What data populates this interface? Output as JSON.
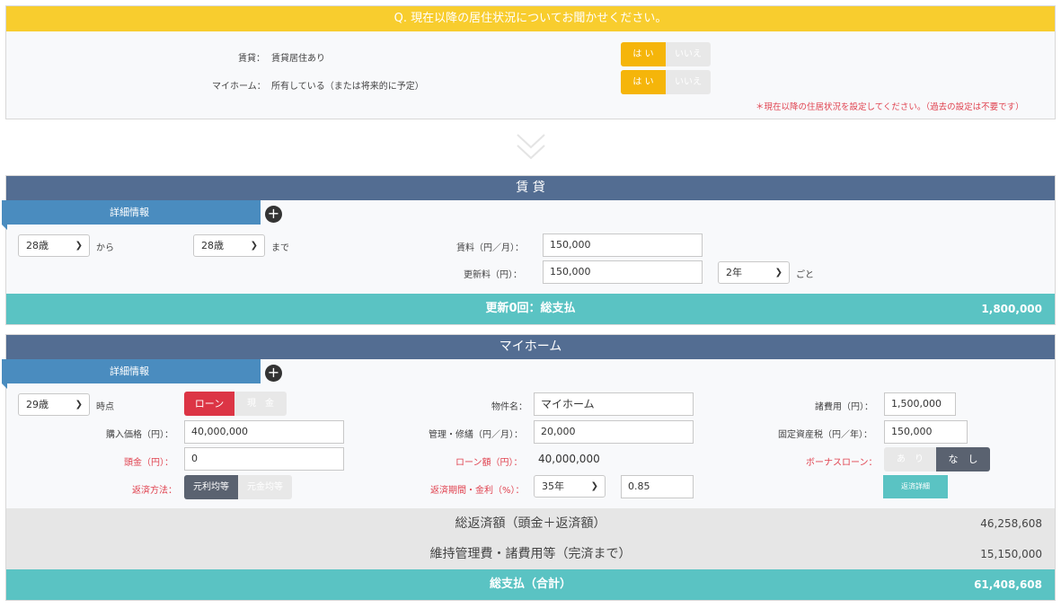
{
  "question": {
    "header": "Q. 現在以降の居住状況についてお聞かせください。",
    "rows": [
      {
        "label": "賃貸：",
        "value": "賃貸居住あり",
        "yes": "は い",
        "no": "いいえ"
      },
      {
        "label": "マイホーム：",
        "value": "所有している（または将来的に予定）",
        "yes": "は い",
        "no": "いいえ"
      }
    ],
    "note": "＊現在以降の住居状況を設定してください。（過去の設定は不要です）"
  },
  "rent": {
    "title": "賃 貸",
    "detail_tab": "詳細情報",
    "plus": "+",
    "from_age": "28歳",
    "from_label": "から",
    "to_age": "28歳",
    "to_label": "まで",
    "rent_label": "賃料（円／月）：",
    "rent_value": "150,000",
    "renewal_label": "更新料（円）：",
    "renewal_value": "150,000",
    "renewal_period": "2年",
    "renewal_suffix": "ごと",
    "total_label": "更新0回：総支払",
    "total_value": "1,800,000"
  },
  "home": {
    "title": "マイホーム",
    "detail_tab": "詳細情報",
    "plus": "+",
    "age": "29歳",
    "age_label": "時点",
    "loan_btn": "ローン",
    "cash_btn": "現　金",
    "price_label": "購入価格（円）：",
    "price_value": "40,000,000",
    "down_label": "頭金（円）：",
    "down_value": "0",
    "repay_method_label": "返済方法：",
    "repay_equal_payment": "元利均等",
    "repay_equal_principal": "元金均等",
    "property_label": "物件名：",
    "property_value": "マイホーム",
    "mgmt_label": "管理・修繕（円／月）：",
    "mgmt_value": "20,000",
    "loan_amount_label": "ローン額（円）：",
    "loan_amount_value": "40,000,000",
    "period_label": "返済期間・金利（%）：",
    "period_value": "35年",
    "rate_value": "0.85",
    "fees_label": "諸費用（円）：",
    "fees_value": "1,500,000",
    "tax_label": "固定資産税（円／年）：",
    "tax_value": "150,000",
    "bonus_label": "ボーナスローン：",
    "bonus_yes": "あ　り",
    "bonus_no": "な　し",
    "repay_detail_btn": "返済詳細",
    "total_repay_label": "総返済額（頭金＋返済額）",
    "total_repay_value": "46,258,608",
    "maint_label": "維持管理費・諸費用等（完済まで）",
    "maint_value": "15,150,000",
    "grand_label": "総支払（合計）",
    "grand_value": "61,408,608"
  },
  "colors": {
    "yellow": "#f8cd2e",
    "navy": "#536d92",
    "blue_tab": "#4a8cbf",
    "teal": "#5ac3c3",
    "red": "#dc3545",
    "dark_toggle": "#5a6270"
  }
}
